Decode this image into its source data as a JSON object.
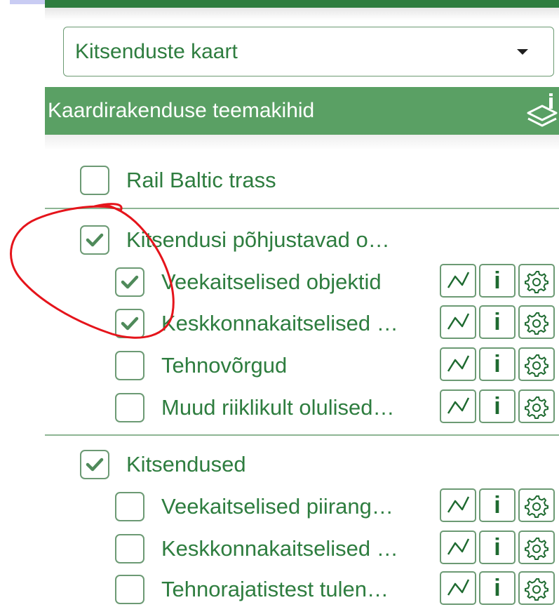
{
  "map_selector": {
    "value": "Kitsenduste kaart",
    "icon": "chevron-down-icon"
  },
  "layers_panel": {
    "title": "Kaardirakenduse teemakihid",
    "icon": "layers-info-icon"
  },
  "colors": {
    "primary": "#2e7d3f",
    "header_bg": "#5aa064",
    "border": "#6c9a74",
    "annotation": "#e5141b"
  },
  "layers": [
    {
      "label": "Rail Baltic trass",
      "checked": false
    },
    {
      "label": "Kitsendusi põhjustavad o…",
      "checked": true,
      "children": [
        {
          "label": "Veekaitselised objektid",
          "checked": true
        },
        {
          "label": "Keskkonnakaitselised …",
          "checked": true
        },
        {
          "label": "Tehnovõrgud",
          "checked": false
        },
        {
          "label": "Muud riiklikult olulised…",
          "checked": false
        }
      ]
    },
    {
      "label": "Kitsendused",
      "checked": true,
      "children": [
        {
          "label": "Veekaitselised piirang…",
          "checked": false
        },
        {
          "label": "Keskkonnakaitselised …",
          "checked": false
        },
        {
          "label": "Tehnorajatistest tulen…",
          "checked": false
        }
      ]
    }
  ],
  "layer_actions": {
    "legend_icon": "line-chart-icon",
    "info_label": "i",
    "settings_icon": "gear-icon"
  }
}
